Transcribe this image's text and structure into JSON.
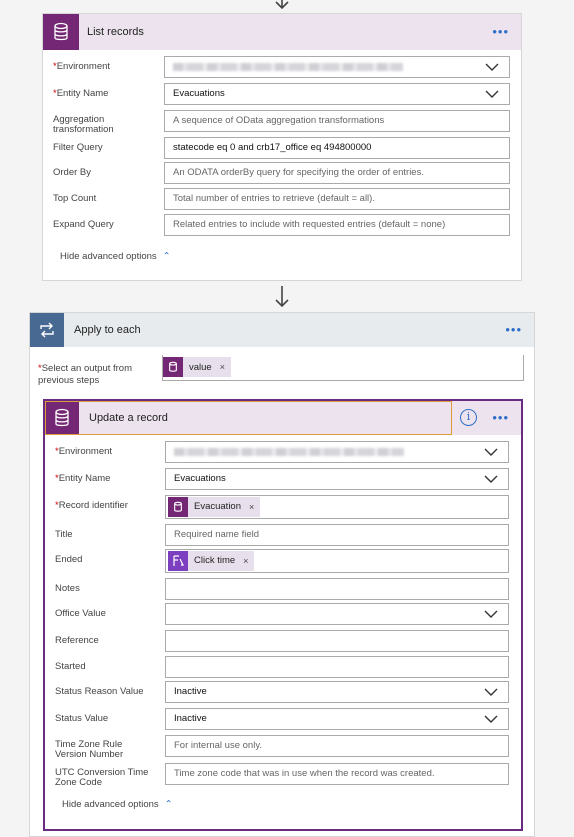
{
  "list_records": {
    "title": "List records",
    "more": "•••",
    "fields": {
      "environment": {
        "label": "Environment"
      },
      "entity_name": {
        "label": "Entity Name",
        "value": "Evacuations"
      },
      "aggregation": {
        "label": "Aggregation transformation",
        "placeholder": "A sequence of OData aggregation transformations"
      },
      "filter_query": {
        "label": "Filter Query",
        "value": "statecode eq 0 and crb17_office eq 494800000"
      },
      "order_by": {
        "label": "Order By",
        "placeholder": "An ODATA orderBy query for specifying the order of entries."
      },
      "top_count": {
        "label": "Top Count",
        "placeholder": "Total number of entries to retrieve (default = all)."
      },
      "expand_query": {
        "label": "Expand Query",
        "placeholder": "Related entries to include with requested entries (default = none)"
      }
    },
    "hide_advanced": "Hide advanced options"
  },
  "apply_to_each": {
    "title": "Apply to each",
    "more": "•••",
    "select_label": "Select an output from previous steps",
    "token": "value",
    "remove": "×"
  },
  "update_record": {
    "title": "Update a record",
    "info": "i",
    "more": "•••",
    "fields": {
      "environment": {
        "label": "Environment"
      },
      "entity_name": {
        "label": "Entity Name",
        "value": "Evacuations"
      },
      "record_identifier": {
        "label": "Record identifier",
        "token": "Evacuation"
      },
      "title": {
        "label": "Title",
        "placeholder": "Required name field"
      },
      "ended": {
        "label": "Ended",
        "token": "Click time"
      },
      "notes": {
        "label": "Notes"
      },
      "office_value": {
        "label": "Office Value"
      },
      "reference": {
        "label": "Reference"
      },
      "started": {
        "label": "Started"
      },
      "status_reason": {
        "label": "Status Reason Value",
        "value": "Inactive"
      },
      "status_value": {
        "label": "Status Value",
        "value": "Inactive"
      },
      "tz_rule": {
        "label": "Time Zone Rule Version Number",
        "placeholder": "For internal use only."
      },
      "utc_conversion": {
        "label": "UTC Conversion Time Zone Code",
        "placeholder": "Time zone code that was in use when the record was created."
      }
    },
    "hide_advanced": "Hide advanced options"
  },
  "colors": {
    "dataverse": "#742774",
    "loop": "#486991",
    "accent": "#2f6fc8",
    "required": "#cc0000",
    "selected_border": "#6a2b83"
  }
}
